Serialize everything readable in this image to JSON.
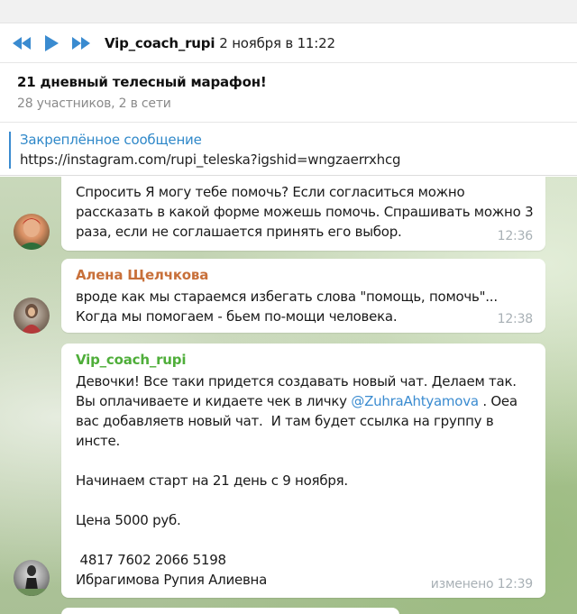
{
  "player": {
    "author": "Vip_coach_rupi",
    "date": "2 ноября в 11:22",
    "icons": [
      "rewind-icon",
      "play-icon",
      "fast-forward-icon"
    ],
    "accent": "#3a8bd0"
  },
  "chat": {
    "title": "21 дневный телесный марафон!",
    "subtitle": "28 участников, 2 в сети"
  },
  "pinned": {
    "title": "Закреплённое сообщение",
    "text": "https://instagram.com/rupi_teleska?igshid=wngzaerrxhcg"
  },
  "messages": [
    {
      "sender": "",
      "text": "Спросить Я могу тебе помочь? Если согласиться можно рассказать в какой форме можешь помочь. Спрашивать можно 3 раза, если не соглашается принять его выбор.",
      "time": "12:36"
    },
    {
      "sender": "Алена Щелчкова",
      "sender_color": "#c8703a",
      "lines": [
        "вроде как мы стараемся избегать слова \"помощь, помочь\"...",
        "Когда мы помогаем - бьем по-мощи человека."
      ],
      "time": "12:38"
    },
    {
      "sender": "Vip_coach_rupi",
      "sender_color": "#4fae3a",
      "text_before_mention": "Девочки! Все таки придется создавать новый чат. Делаем так. Вы оплачиваете и кидаете чек в личку ",
      "mention": "@ZuhraAhtyamova",
      "text_after_mention": " . Оеа вас добавляетв новый чат.  И там будет ссылка на группу в инсте.",
      "paragraphs": [
        "Начинаем старт на 21 день с 9 ноября.",
        "Цена 5000 руб.",
        " 4817 7602 2066 5198",
        "Ибрагимова Рупия Алиевна"
      ],
      "edited_time": "изменено 12:39"
    }
  ]
}
